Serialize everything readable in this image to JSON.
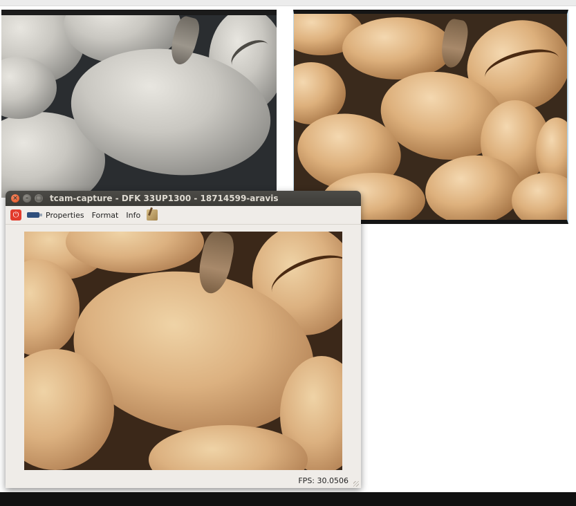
{
  "window": {
    "title": "tcam-capture - DFK 33UP1300 - 18714599-aravis",
    "controls": {
      "close": "×",
      "minimize": "–",
      "maximize": "□"
    }
  },
  "toolbar": {
    "power_glyph": "⏻",
    "menu": [
      "Properties",
      "Format",
      "Info"
    ]
  },
  "status": {
    "fps": "FPS: 30.0506"
  },
  "images": {
    "left_preview": "grey coffee beans (raw video)",
    "right_preview": "coffee beans (color)",
    "capture_preview": "coffee beans (live)"
  },
  "colors": {
    "titlebar": "#3c3b37",
    "close_button": "#e2501e",
    "window_bg": "#efece8",
    "power_icon": "#e23b2c",
    "desktop_bar": "#111111"
  }
}
